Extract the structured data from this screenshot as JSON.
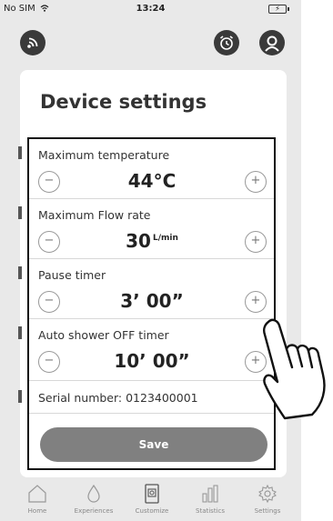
{
  "status_bar": {
    "carrier": "No SIM",
    "time": "13:24",
    "battery_symbol": "⚡"
  },
  "header": {
    "left_icon": "wifi-icon",
    "right_icons": [
      "alarm-clock-icon",
      "user-profile-icon"
    ]
  },
  "page": {
    "title": "Device settings"
  },
  "settings": [
    {
      "label": "Maximum temperature",
      "value": "44°C",
      "unit": "",
      "minus": "−",
      "plus": "+"
    },
    {
      "label": "Maximum Flow rate",
      "value": "30",
      "unit": "L/min",
      "minus": "−",
      "plus": "+"
    },
    {
      "label": "Pause timer",
      "value": "3’ 00”",
      "unit": "",
      "minus": "−",
      "plus": "+"
    },
    {
      "label": "Auto shower OFF timer",
      "value": "10’ 00”",
      "unit": "",
      "minus": "−",
      "plus": "+"
    }
  ],
  "serial": {
    "text": "Serial number: 0123400001"
  },
  "save_button": {
    "label": "Save"
  },
  "tabs": [
    {
      "label": "Home",
      "icon": "home-icon"
    },
    {
      "label": "Experiences",
      "icon": "water-drop-icon"
    },
    {
      "label": "Customize",
      "icon": "customize-icon"
    },
    {
      "label": "Statistics",
      "icon": "bar-chart-icon"
    },
    {
      "label": "Settings",
      "icon": "gear-icon"
    }
  ],
  "colors": {
    "background": "#e9e9e9",
    "card": "#ffffff",
    "header_icon": "#3a3a3a",
    "save_button": "#808080",
    "highlight_border": "#111111"
  }
}
